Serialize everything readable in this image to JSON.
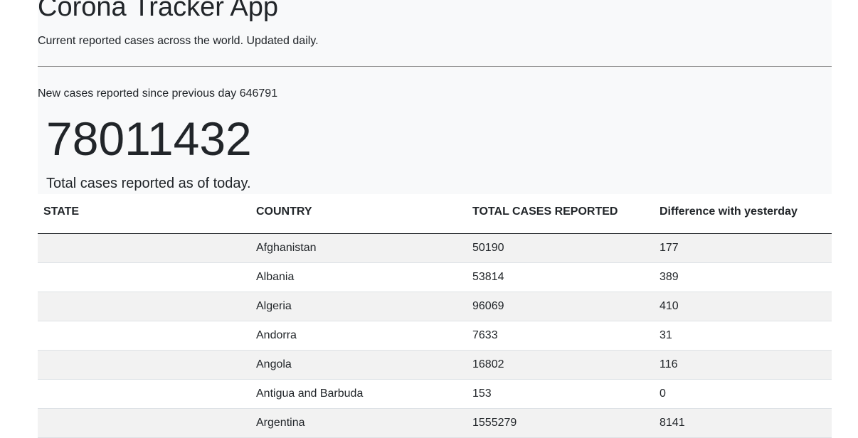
{
  "header": {
    "title": "Corona Tracker App",
    "subtitle": "Current reported cases across the world. Updated daily."
  },
  "stats": {
    "new_cases_text": "New cases reported since previous day 646791",
    "total_cases": "78011432",
    "total_caption": "Total cases reported as of today."
  },
  "table": {
    "columns": [
      "STATE",
      "COUNTRY",
      "TOTAL CASES REPORTED",
      "Difference with yesterday"
    ],
    "rows": [
      {
        "state": "",
        "country": "Afghanistan",
        "total": "50190",
        "diff": "177"
      },
      {
        "state": "",
        "country": "Albania",
        "total": "53814",
        "diff": "389"
      },
      {
        "state": "",
        "country": "Algeria",
        "total": "96069",
        "diff": "410"
      },
      {
        "state": "",
        "country": "Andorra",
        "total": "7633",
        "diff": "31"
      },
      {
        "state": "",
        "country": "Angola",
        "total": "16802",
        "diff": "116"
      },
      {
        "state": "",
        "country": "Antigua and Barbuda",
        "total": "153",
        "diff": "0"
      },
      {
        "state": "",
        "country": "Argentina",
        "total": "1555279",
        "diff": "8141"
      }
    ]
  }
}
